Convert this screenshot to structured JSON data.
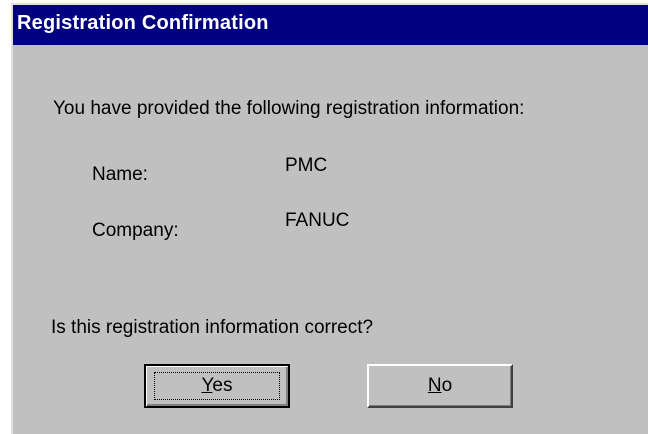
{
  "dialog": {
    "title": "Registration Confirmation",
    "intro": "You have provided the following registration information:",
    "fields": [
      {
        "label": "Name:",
        "value": "PMC"
      },
      {
        "label": "Company:",
        "value": "FANUC"
      }
    ],
    "question": "Is this registration information correct?",
    "buttons": {
      "yes": {
        "mnemonic": "Y",
        "rest": "es"
      },
      "no": {
        "mnemonic": "N",
        "rest": "o"
      }
    }
  },
  "colors": {
    "titlebar": "#000080",
    "face": "#c0c0c0"
  }
}
